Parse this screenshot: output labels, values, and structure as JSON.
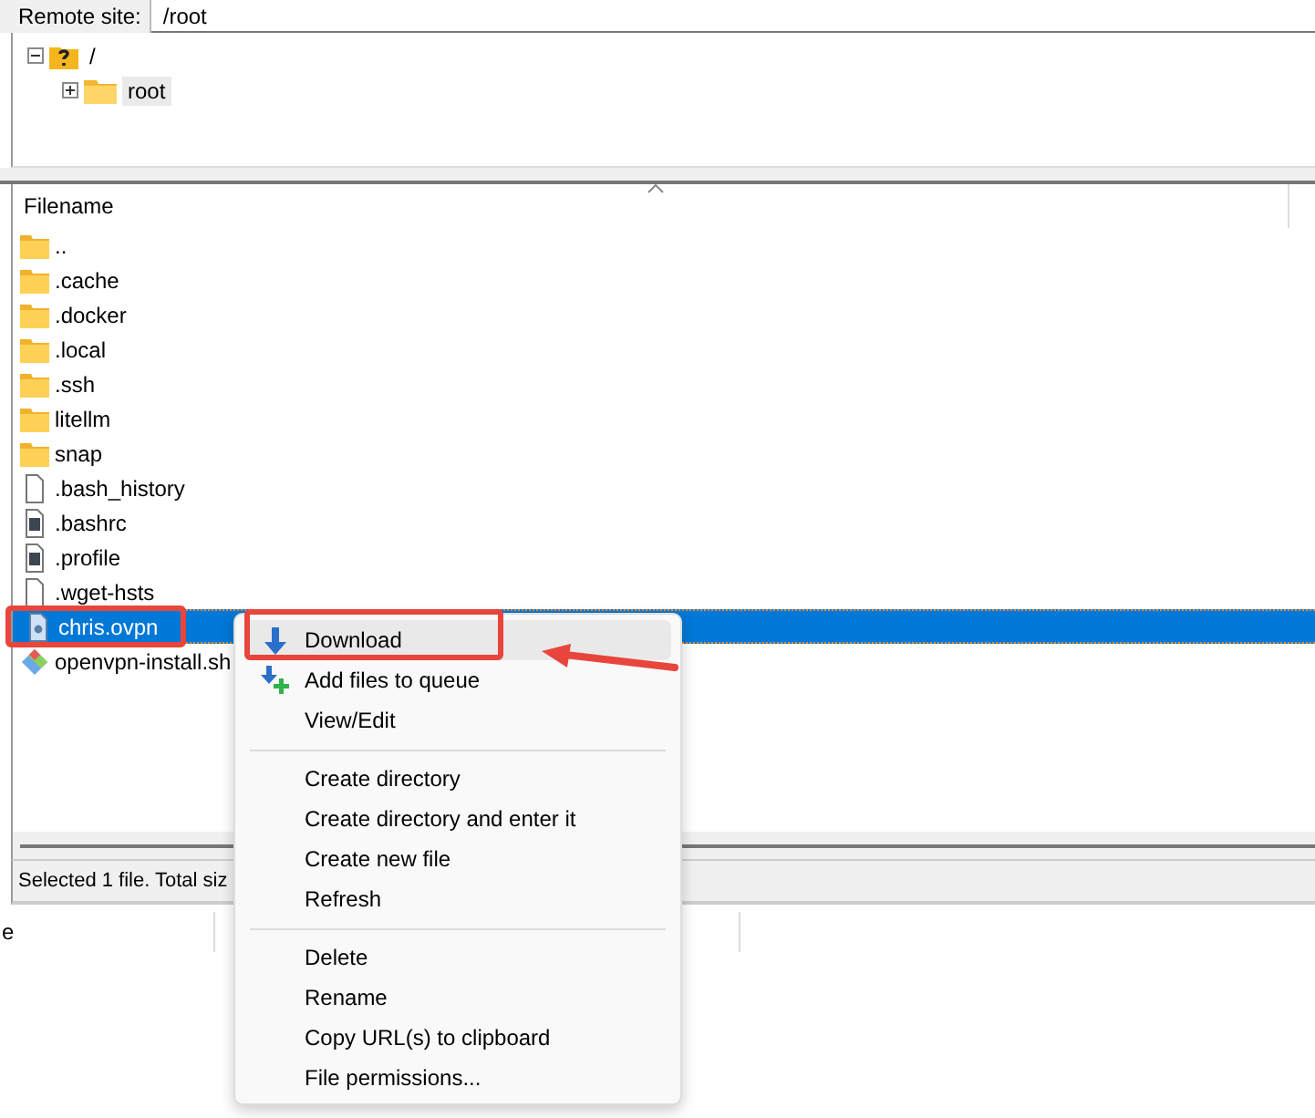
{
  "remote_site": {
    "label": "Remote site:",
    "path": "/root"
  },
  "tree": [
    {
      "label": "/",
      "expanded": true,
      "selected": false,
      "children": [
        {
          "label": "root",
          "expanded": false,
          "selected": true
        }
      ]
    }
  ],
  "file_list": {
    "columns": [
      "Filename"
    ],
    "rows": [
      {
        "name": "..",
        "kind": "folder",
        "selected": false,
        "annotated": false
      },
      {
        "name": ".cache",
        "kind": "folder",
        "selected": false,
        "annotated": false
      },
      {
        "name": ".docker",
        "kind": "folder",
        "selected": false,
        "annotated": false
      },
      {
        "name": ".local",
        "kind": "folder",
        "selected": false,
        "annotated": false
      },
      {
        "name": ".ssh",
        "kind": "folder",
        "selected": false,
        "annotated": false
      },
      {
        "name": "litellm",
        "kind": "folder",
        "selected": false,
        "annotated": false
      },
      {
        "name": "snap",
        "kind": "folder",
        "selected": false,
        "annotated": false
      },
      {
        "name": ".bash_history",
        "kind": "file",
        "selected": false,
        "annotated": false
      },
      {
        "name": ".bashrc",
        "kind": "config",
        "selected": false,
        "annotated": false
      },
      {
        "name": ".profile",
        "kind": "config",
        "selected": false,
        "annotated": false
      },
      {
        "name": ".wget-hsts",
        "kind": "file",
        "selected": false,
        "annotated": false
      },
      {
        "name": "chris.ovpn",
        "kind": "vpn",
        "selected": true,
        "annotated": true
      },
      {
        "name": "openvpn-install.sh",
        "kind": "script",
        "selected": false,
        "annotated": false
      }
    ]
  },
  "status_bar": "Selected 1 file. Total siz",
  "lower_panel": {
    "column_1": "e"
  },
  "context_menu": [
    {
      "kind": "download",
      "label": "Download",
      "hover": true,
      "annotated": true
    },
    {
      "kind": "queue",
      "label": "Add files to queue",
      "hover": false,
      "annotated": false
    },
    {
      "kind": "plain",
      "label": "View/Edit",
      "hover": false,
      "annotated": false
    },
    {
      "kind": "separator"
    },
    {
      "kind": "plain",
      "label": "Create directory",
      "hover": false,
      "annotated": false
    },
    {
      "kind": "plain",
      "label": "Create directory and enter it",
      "hover": false,
      "annotated": false
    },
    {
      "kind": "plain",
      "label": "Create new file",
      "hover": false,
      "annotated": false
    },
    {
      "kind": "plain",
      "label": "Refresh",
      "hover": false,
      "annotated": false
    },
    {
      "kind": "separator"
    },
    {
      "kind": "plain",
      "label": "Delete",
      "hover": false,
      "annotated": false
    },
    {
      "kind": "plain",
      "label": "Rename",
      "hover": false,
      "annotated": false
    },
    {
      "kind": "plain",
      "label": "Copy URL(s) to clipboard",
      "hover": false,
      "annotated": false
    },
    {
      "kind": "plain",
      "label": "File permissions...",
      "hover": false,
      "annotated": false
    }
  ]
}
